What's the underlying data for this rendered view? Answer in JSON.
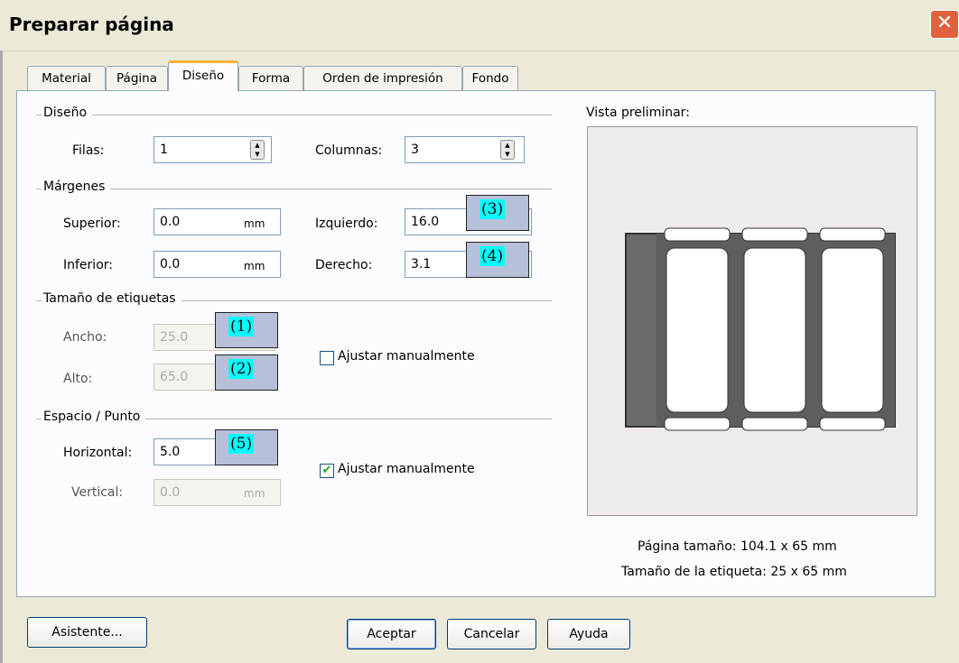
{
  "window": {
    "title": "Preparar página",
    "close_glyph": "✕"
  },
  "tabs": [
    {
      "label": "Material",
      "active": false
    },
    {
      "label": "Página",
      "active": false
    },
    {
      "label": "Diseño",
      "active": true
    },
    {
      "label": "Forma",
      "active": false
    },
    {
      "label": "Orden de impresión",
      "active": false
    },
    {
      "label": "Fondo",
      "active": false
    }
  ],
  "diseno": {
    "title": "Diseño",
    "rows_label": "Filas:",
    "rows_value": "1",
    "cols_label": "Columnas:",
    "cols_value": "3"
  },
  "margenes": {
    "title": "Márgenes",
    "superior_label": "Superior:",
    "superior_value": "0.0",
    "superior_unit": "mm",
    "inferior_label": "Inferior:",
    "inferior_value": "0.0",
    "inferior_unit": "mm",
    "izquierdo_label": "Izquierdo:",
    "izquierdo_value": "16.0",
    "derecho_label": "Derecho:",
    "derecho_value": "3.1"
  },
  "tamano": {
    "title": "Tamaño de etiquetas",
    "ancho_label": "Ancho:",
    "ancho_value": "25.0",
    "alto_label": "Alto:",
    "alto_value": "65.0",
    "manual_label": "Ajustar manualmente",
    "manual_checked": false
  },
  "espacio": {
    "title": "Espacio / Punto",
    "horizontal_label": "Horizontal:",
    "horizontal_value": "5.0",
    "vertical_label": "Vertical:",
    "vertical_value": "0.0",
    "vertical_unit": "mm",
    "manual_label": "Ajustar manualmente",
    "manual_checked": true
  },
  "callouts": {
    "c1": "(1)",
    "c2": "(2)",
    "c3": "(3)",
    "c4": "(4)",
    "c5": "(5)"
  },
  "preview": {
    "title": "Vista preliminar:",
    "page_size": "Página tamaño:  104.1 x 65  mm",
    "label_size": "Tamaño de la etiqueta:  25 x 65  mm",
    "label_columns": 3
  },
  "buttons": {
    "wizard": "Asistente...",
    "ok": "Aceptar",
    "cancel": "Cancelar",
    "help": "Ayuda"
  },
  "colors": {
    "accent_tab": "#f5b335",
    "callout_bg": "#b7c0d9",
    "callout_highlight": "#00ffff",
    "check_mark": "#21a121"
  }
}
